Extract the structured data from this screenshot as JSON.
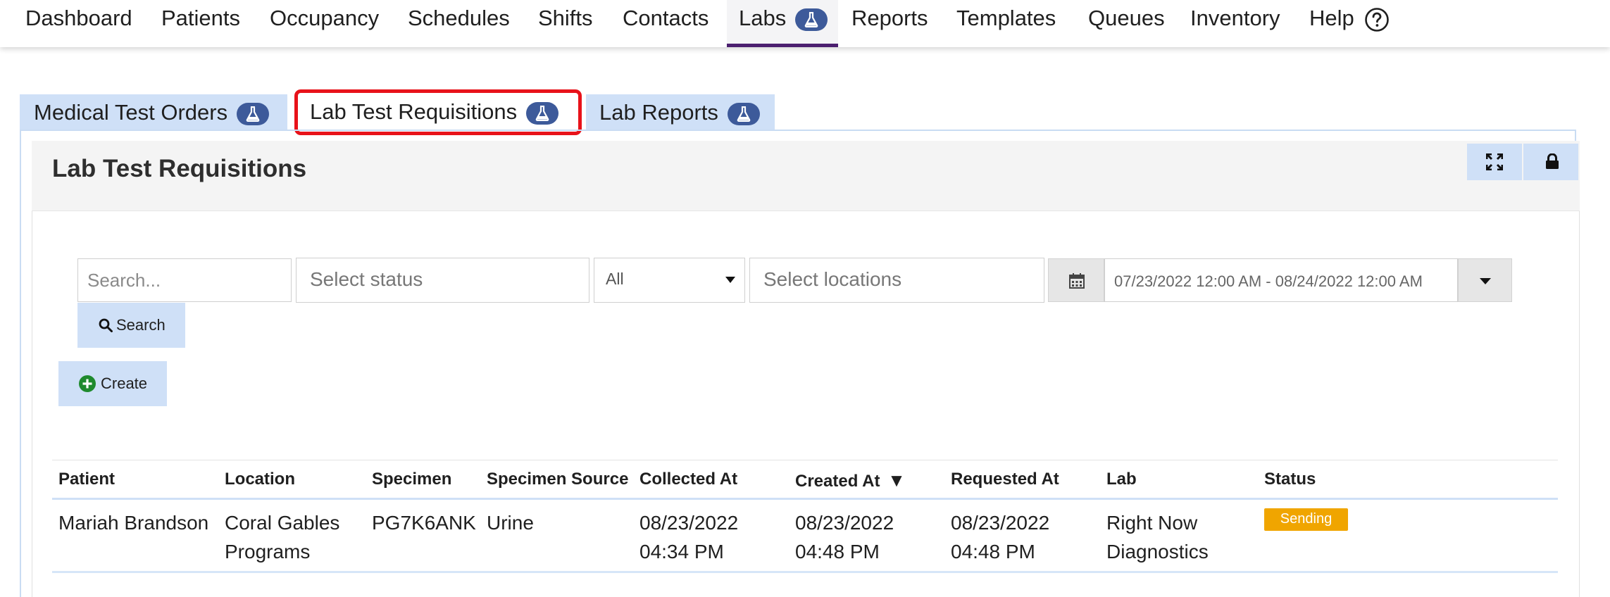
{
  "nav": {
    "items": [
      {
        "label": "Dashboard"
      },
      {
        "label": "Patients"
      },
      {
        "label": "Occupancy"
      },
      {
        "label": "Schedules"
      },
      {
        "label": "Shifts"
      },
      {
        "label": "Contacts"
      },
      {
        "label": "Labs",
        "icon": "flask-icon",
        "active": true
      },
      {
        "label": "Reports"
      },
      {
        "label": "Templates"
      },
      {
        "label": "Queues"
      },
      {
        "label": "Inventory"
      },
      {
        "label": "Help",
        "icon": "help-circle-icon"
      }
    ]
  },
  "subtabs": [
    {
      "label": "Medical Test Orders",
      "icon": "flask-icon"
    },
    {
      "label": "Lab Test Requisitions",
      "icon": "flask-icon",
      "selected": true
    },
    {
      "label": "Lab Reports",
      "icon": "flask-icon"
    }
  ],
  "panel": {
    "title": "Lab Test Requisitions",
    "buttons": [
      {
        "icon": "expand-icon"
      },
      {
        "icon": "lock-icon"
      }
    ]
  },
  "filters": {
    "search_placeholder": "Search...",
    "status_placeholder": "Select status",
    "scope_value": "All",
    "locations_placeholder": "Select locations",
    "date_range": "07/23/2022 12:00 AM - 08/24/2022 12:00 AM",
    "search_button": "Search",
    "create_button": "Create"
  },
  "table": {
    "columns": [
      "Patient",
      "Location",
      "Specimen",
      "Specimen Source",
      "Collected At",
      "Created At",
      "Requested At",
      "Lab",
      "Status"
    ],
    "sort_indicator": "▼",
    "rows": [
      {
        "patient": "Mariah Brandson",
        "location_l1": "Coral Gables",
        "location_l2": "Programs",
        "specimen": "PG7K6ANK",
        "source": "Urine",
        "collected_date": "08/23/2022",
        "collected_time": "04:34 PM",
        "created_date": "08/23/2022",
        "created_time": "04:48 PM",
        "requested_date": "08/23/2022",
        "requested_time": "04:48 PM",
        "lab_l1": "Right Now",
        "lab_l2": "Diagnostics",
        "status": "Sending"
      }
    ]
  },
  "colors": {
    "nav_active_underline": "#4b1f6f",
    "badge": "#3d5a9a",
    "tab_bg": "#cfe0f7",
    "highlight": "#e8121a",
    "status_sending": "#f0a500"
  }
}
